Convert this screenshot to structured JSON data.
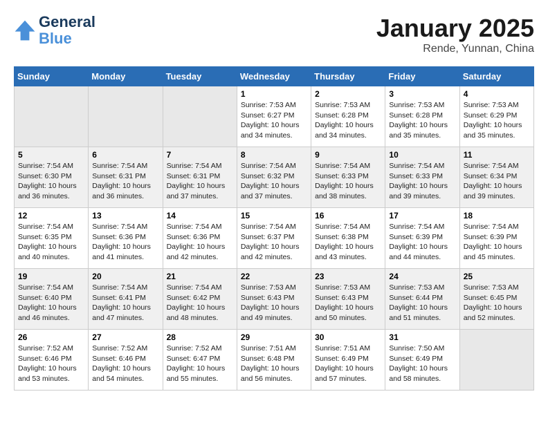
{
  "header": {
    "logo_line1": "General",
    "logo_line2": "Blue",
    "main_title": "January 2025",
    "subtitle": "Rende, Yunnan, China"
  },
  "weekdays": [
    "Sunday",
    "Monday",
    "Tuesday",
    "Wednesday",
    "Thursday",
    "Friday",
    "Saturday"
  ],
  "rows": [
    [
      {
        "day": "",
        "info": ""
      },
      {
        "day": "",
        "info": ""
      },
      {
        "day": "",
        "info": ""
      },
      {
        "day": "1",
        "info": "Sunrise: 7:53 AM\nSunset: 6:27 PM\nDaylight: 10 hours\nand 34 minutes."
      },
      {
        "day": "2",
        "info": "Sunrise: 7:53 AM\nSunset: 6:28 PM\nDaylight: 10 hours\nand 34 minutes."
      },
      {
        "day": "3",
        "info": "Sunrise: 7:53 AM\nSunset: 6:28 PM\nDaylight: 10 hours\nand 35 minutes."
      },
      {
        "day": "4",
        "info": "Sunrise: 7:53 AM\nSunset: 6:29 PM\nDaylight: 10 hours\nand 35 minutes."
      }
    ],
    [
      {
        "day": "5",
        "info": "Sunrise: 7:54 AM\nSunset: 6:30 PM\nDaylight: 10 hours\nand 36 minutes."
      },
      {
        "day": "6",
        "info": "Sunrise: 7:54 AM\nSunset: 6:31 PM\nDaylight: 10 hours\nand 36 minutes."
      },
      {
        "day": "7",
        "info": "Sunrise: 7:54 AM\nSunset: 6:31 PM\nDaylight: 10 hours\nand 37 minutes."
      },
      {
        "day": "8",
        "info": "Sunrise: 7:54 AM\nSunset: 6:32 PM\nDaylight: 10 hours\nand 37 minutes."
      },
      {
        "day": "9",
        "info": "Sunrise: 7:54 AM\nSunset: 6:33 PM\nDaylight: 10 hours\nand 38 minutes."
      },
      {
        "day": "10",
        "info": "Sunrise: 7:54 AM\nSunset: 6:33 PM\nDaylight: 10 hours\nand 39 minutes."
      },
      {
        "day": "11",
        "info": "Sunrise: 7:54 AM\nSunset: 6:34 PM\nDaylight: 10 hours\nand 39 minutes."
      }
    ],
    [
      {
        "day": "12",
        "info": "Sunrise: 7:54 AM\nSunset: 6:35 PM\nDaylight: 10 hours\nand 40 minutes."
      },
      {
        "day": "13",
        "info": "Sunrise: 7:54 AM\nSunset: 6:36 PM\nDaylight: 10 hours\nand 41 minutes."
      },
      {
        "day": "14",
        "info": "Sunrise: 7:54 AM\nSunset: 6:36 PM\nDaylight: 10 hours\nand 42 minutes."
      },
      {
        "day": "15",
        "info": "Sunrise: 7:54 AM\nSunset: 6:37 PM\nDaylight: 10 hours\nand 42 minutes."
      },
      {
        "day": "16",
        "info": "Sunrise: 7:54 AM\nSunset: 6:38 PM\nDaylight: 10 hours\nand 43 minutes."
      },
      {
        "day": "17",
        "info": "Sunrise: 7:54 AM\nSunset: 6:39 PM\nDaylight: 10 hours\nand 44 minutes."
      },
      {
        "day": "18",
        "info": "Sunrise: 7:54 AM\nSunset: 6:39 PM\nDaylight: 10 hours\nand 45 minutes."
      }
    ],
    [
      {
        "day": "19",
        "info": "Sunrise: 7:54 AM\nSunset: 6:40 PM\nDaylight: 10 hours\nand 46 minutes."
      },
      {
        "day": "20",
        "info": "Sunrise: 7:54 AM\nSunset: 6:41 PM\nDaylight: 10 hours\nand 47 minutes."
      },
      {
        "day": "21",
        "info": "Sunrise: 7:54 AM\nSunset: 6:42 PM\nDaylight: 10 hours\nand 48 minutes."
      },
      {
        "day": "22",
        "info": "Sunrise: 7:53 AM\nSunset: 6:43 PM\nDaylight: 10 hours\nand 49 minutes."
      },
      {
        "day": "23",
        "info": "Sunrise: 7:53 AM\nSunset: 6:43 PM\nDaylight: 10 hours\nand 50 minutes."
      },
      {
        "day": "24",
        "info": "Sunrise: 7:53 AM\nSunset: 6:44 PM\nDaylight: 10 hours\nand 51 minutes."
      },
      {
        "day": "25",
        "info": "Sunrise: 7:53 AM\nSunset: 6:45 PM\nDaylight: 10 hours\nand 52 minutes."
      }
    ],
    [
      {
        "day": "26",
        "info": "Sunrise: 7:52 AM\nSunset: 6:46 PM\nDaylight: 10 hours\nand 53 minutes."
      },
      {
        "day": "27",
        "info": "Sunrise: 7:52 AM\nSunset: 6:46 PM\nDaylight: 10 hours\nand 54 minutes."
      },
      {
        "day": "28",
        "info": "Sunrise: 7:52 AM\nSunset: 6:47 PM\nDaylight: 10 hours\nand 55 minutes."
      },
      {
        "day": "29",
        "info": "Sunrise: 7:51 AM\nSunset: 6:48 PM\nDaylight: 10 hours\nand 56 minutes."
      },
      {
        "day": "30",
        "info": "Sunrise: 7:51 AM\nSunset: 6:49 PM\nDaylight: 10 hours\nand 57 minutes."
      },
      {
        "day": "31",
        "info": "Sunrise: 7:50 AM\nSunset: 6:49 PM\nDaylight: 10 hours\nand 58 minutes."
      },
      {
        "day": "",
        "info": ""
      }
    ]
  ]
}
